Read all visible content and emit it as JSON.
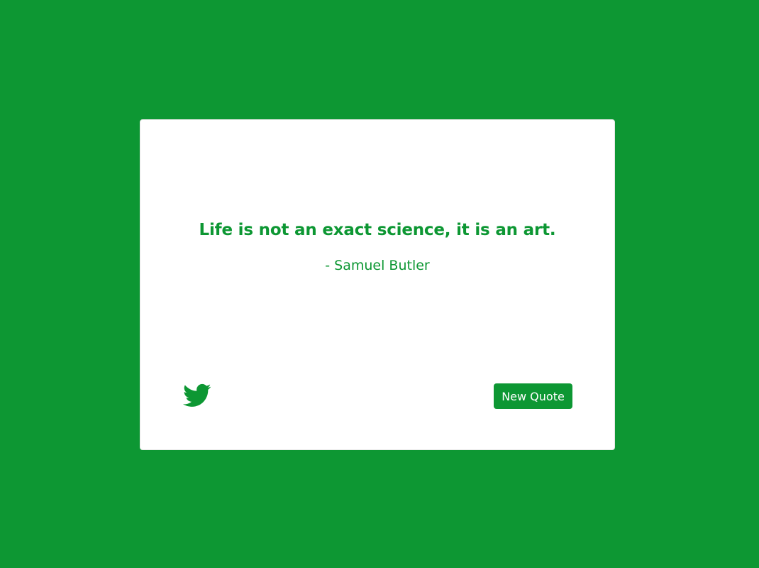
{
  "theme": {
    "accent": "#0d9733",
    "card_background": "#ffffff"
  },
  "quote": {
    "text": "Life is not an exact science, it is an art.",
    "author": "- Samuel Butler"
  },
  "actions": {
    "tweet_icon": "twitter-bird-icon",
    "new_quote_label": "New Quote"
  }
}
